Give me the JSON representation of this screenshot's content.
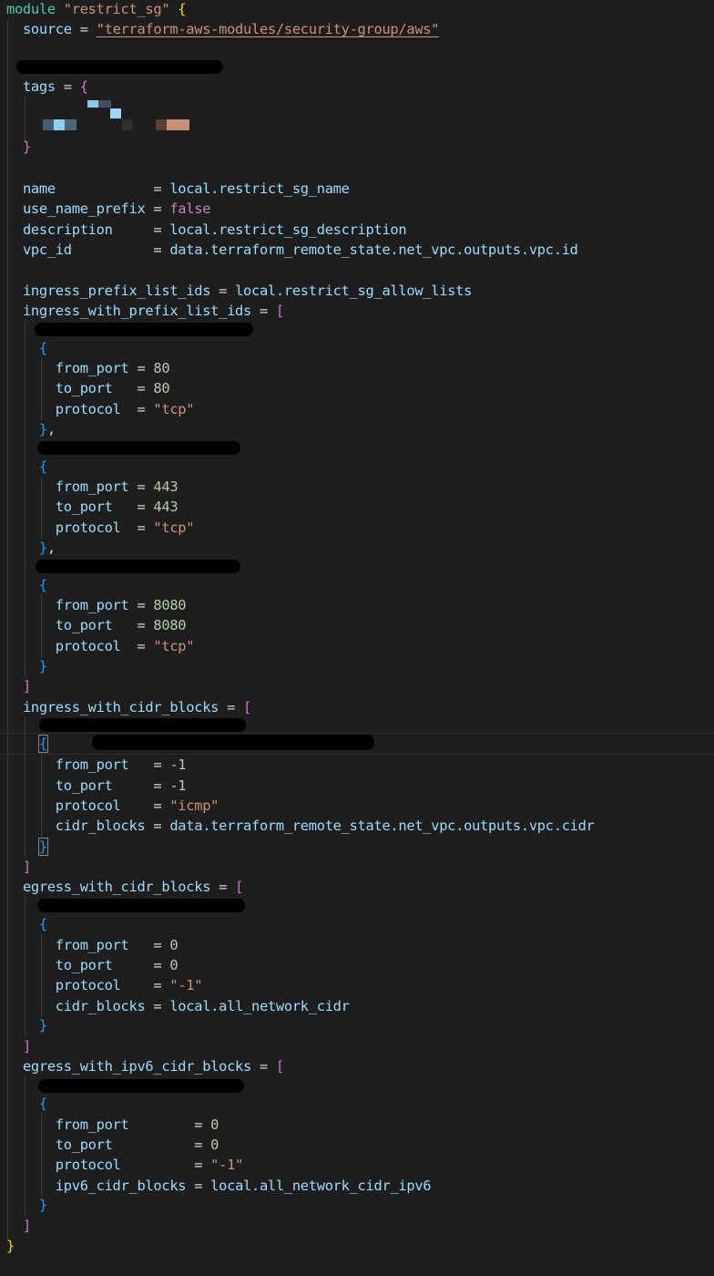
{
  "code": {
    "module_kw": "module",
    "module_name": "\"restrict_sg\"",
    "source_key": "source",
    "source_val": "\"terraform-aws-modules/security-group/aws\"",
    "tags_key": "tags",
    "name_key": "name",
    "name_val": "local.restrict_sg_name",
    "prefix_key": "use_name_prefix",
    "prefix_val": "false",
    "desc_key": "description",
    "desc_val": "local.restrict_sg_description",
    "vpc_key": "vpc_id",
    "vpc_val": "data.terraform_remote_state.net_vpc.outputs.vpc.id",
    "plids_key": "ingress_prefix_list_ids",
    "plids_val": "local.restrict_sg_allow_lists",
    "iwpl_key": "ingress_with_prefix_list_ids",
    "iwcb_key": "ingress_with_cidr_blocks",
    "ewcb_key": "egress_with_cidr_blocks",
    "ewipv6_key": "egress_with_ipv6_cidr_blocks",
    "from_port": "from_port",
    "to_port": "to_port",
    "protocol": "protocol",
    "cidr_blocks": "cidr_blocks",
    "ipv6_cidr_blocks": "ipv6_cidr_blocks",
    "v80": "80",
    "v443": "443",
    "v8080": "8080",
    "vneg1": "-1",
    "v0": "0",
    "tcp": "\"tcp\"",
    "icmp": "\"icmp\"",
    "proto_all": "\"-1\"",
    "vpc_cidr": "data.terraform_remote_state.net_vpc.outputs.vpc.cidr",
    "all_cidr": "local.all_network_cidr",
    "all_cidr6": "local.all_network_cidr_ipv6"
  },
  "colors": {
    "background": "#1e1e1e",
    "keyword": "#4ec9b0",
    "string": "#ce9178",
    "attribute": "#9cdcfe",
    "number": "#b5cea8",
    "boolean": "#c586c0",
    "bracket_level1": "#ffd700",
    "bracket_level2": "#da70d6",
    "bracket_level3": "#179fff"
  }
}
